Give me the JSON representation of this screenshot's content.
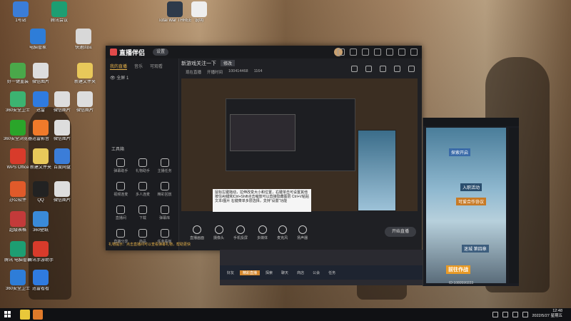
{
  "desktop": {
    "icons": [
      {
        "label": "1号站",
        "color": "#3b7dd8"
      },
      {
        "label": "腾讯会议",
        "color": "#1d9e72"
      },
      {
        "label": "Total War THREE KI...",
        "color": "#2e3a4a"
      },
      {
        "label": "说明",
        "color": "#eeeeee"
      },
      {
        "label": "快速回应",
        "color": "#d8d8d8"
      },
      {
        "label": "电脑管家",
        "color": "#2e7dd8"
      },
      {
        "label": "新建文件夹",
        "color": "#e8c85a"
      },
      {
        "label": "好一键重装",
        "color": "#4aa84a"
      },
      {
        "label": "微信图片",
        "color": "#dddddd"
      },
      {
        "label": "360安全卫士",
        "color": "#3cb371"
      },
      {
        "label": "迅雷",
        "color": "#2f7be0"
      },
      {
        "label": "微信图片",
        "color": "#dddddd"
      },
      {
        "label": "微信图片",
        "color": "#dddddd"
      },
      {
        "label": "360安全浏览器",
        "color": "#2aa52a"
      },
      {
        "label": "迅雷影音",
        "color": "#f07a2a"
      },
      {
        "label": "微信图片",
        "color": "#dddddd"
      },
      {
        "label": "WPS Office",
        "color": "#d83b2b"
      },
      {
        "label": "新建文件夹",
        "color": "#e8c85a"
      },
      {
        "label": "百度网盘",
        "color": "#3b7dd8"
      },
      {
        "label": "办公软件",
        "color": "#e05a2a"
      },
      {
        "label": "QQ",
        "color": "#222222"
      },
      {
        "label": "微信图片",
        "color": "#dddddd"
      },
      {
        "label": "超级表格",
        "color": "#c33a3a"
      },
      {
        "label": "360壁纸",
        "color": "#3a8ad8"
      },
      {
        "label": "腾讯 电脑管家",
        "color": "#1d9e72"
      },
      {
        "label": "腾讯手游助手",
        "color": "#d83b2b"
      },
      {
        "label": "360安全卫士",
        "color": "#2e7dd8"
      },
      {
        "label": "迅雷看看",
        "color": "#2f7be0"
      }
    ]
  },
  "app": {
    "name": "直播伴侣",
    "version_pill": "设置",
    "sidebar_tabs": [
      "我的直播",
      "音乐",
      "可观看"
    ],
    "scene_label": "全屏 1",
    "tools_title": "工具箱",
    "tools": [
      "弹幕助手",
      "礼物助手",
      "主播任务",
      "视频连麦",
      "多人连麦",
      "精彩回放",
      "直播间",
      "下载",
      "弹幕库",
      "直播分享",
      "商品",
      "任务看板"
    ],
    "room_title": "新游戏关注一下",
    "room_title_btn": "修改",
    "stats": [
      "现在直播",
      "开播时间",
      "100414468",
      "1164"
    ],
    "controls": [
      "直播画面",
      "摄像头",
      "手机投屏",
      "多媒体",
      "麦克风",
      "扬声器"
    ],
    "start_button": "开始直播",
    "status_line": "礼物提示：点击直播间可以查看弹幕礼物，帮助更快",
    "tooltip": "鼠标左键拖动，拉伸改变大小和位置，右键单击可设置其他 按住Alt键和Ctrl+Shift点击缩放可以直接隐藏图层 Ctrl+V粘贴文本/图片 右键菜单多层选择，支持“设置”功能"
  },
  "game_bar": [
    "好友",
    "精彩直播",
    "探索",
    "聊天",
    "商店",
    "公会",
    "任务"
  ],
  "emulator": {
    "buttons": [
      "探索开启",
      "入职活动",
      "可爱合作协议",
      "迷城 第四章",
      "前往作战"
    ],
    "id_text": "ID:1080590223"
  },
  "taskbar": {
    "time": "12:48",
    "date": "2022/5/27 星期五"
  }
}
